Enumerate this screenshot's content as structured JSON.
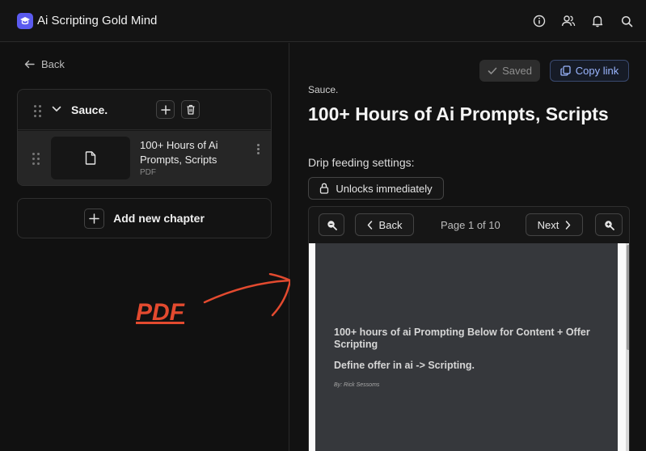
{
  "app": {
    "title": "Ai Scripting Gold Mind"
  },
  "header": {
    "icons": [
      "info-icon",
      "users-icon",
      "bell-icon",
      "search-icon"
    ]
  },
  "left": {
    "back_label": "Back",
    "chapter": {
      "title": "Sauce.",
      "lesson": {
        "title": "100+ Hours of Ai Prompts, Scripts",
        "type": "PDF"
      }
    },
    "add_chapter_label": "Add new chapter"
  },
  "annotation": {
    "text": "PDF",
    "color": "#e34a2f"
  },
  "right": {
    "saved_label": "Saved",
    "copy_link_label": "Copy link",
    "chapter_name": "Sauce.",
    "lesson_title": "100+ Hours of Ai Prompts, Scripts",
    "drip_label": "Drip feeding settings:",
    "unlock_label": "Unlocks immediately",
    "viewer": {
      "back_label": "Back",
      "next_label": "Next",
      "page_indicator": "Page 1 of 10",
      "pdf_heading": "100+ hours of ai Prompting Below for Content + Offer Scripting",
      "pdf_subheading": "Define offer in ai -> Scripting.",
      "pdf_byline": "By: Rick Sessoms"
    }
  },
  "colors": {
    "accent": "#5b5bf0",
    "link": "#9bb6ff",
    "background": "#121212"
  }
}
